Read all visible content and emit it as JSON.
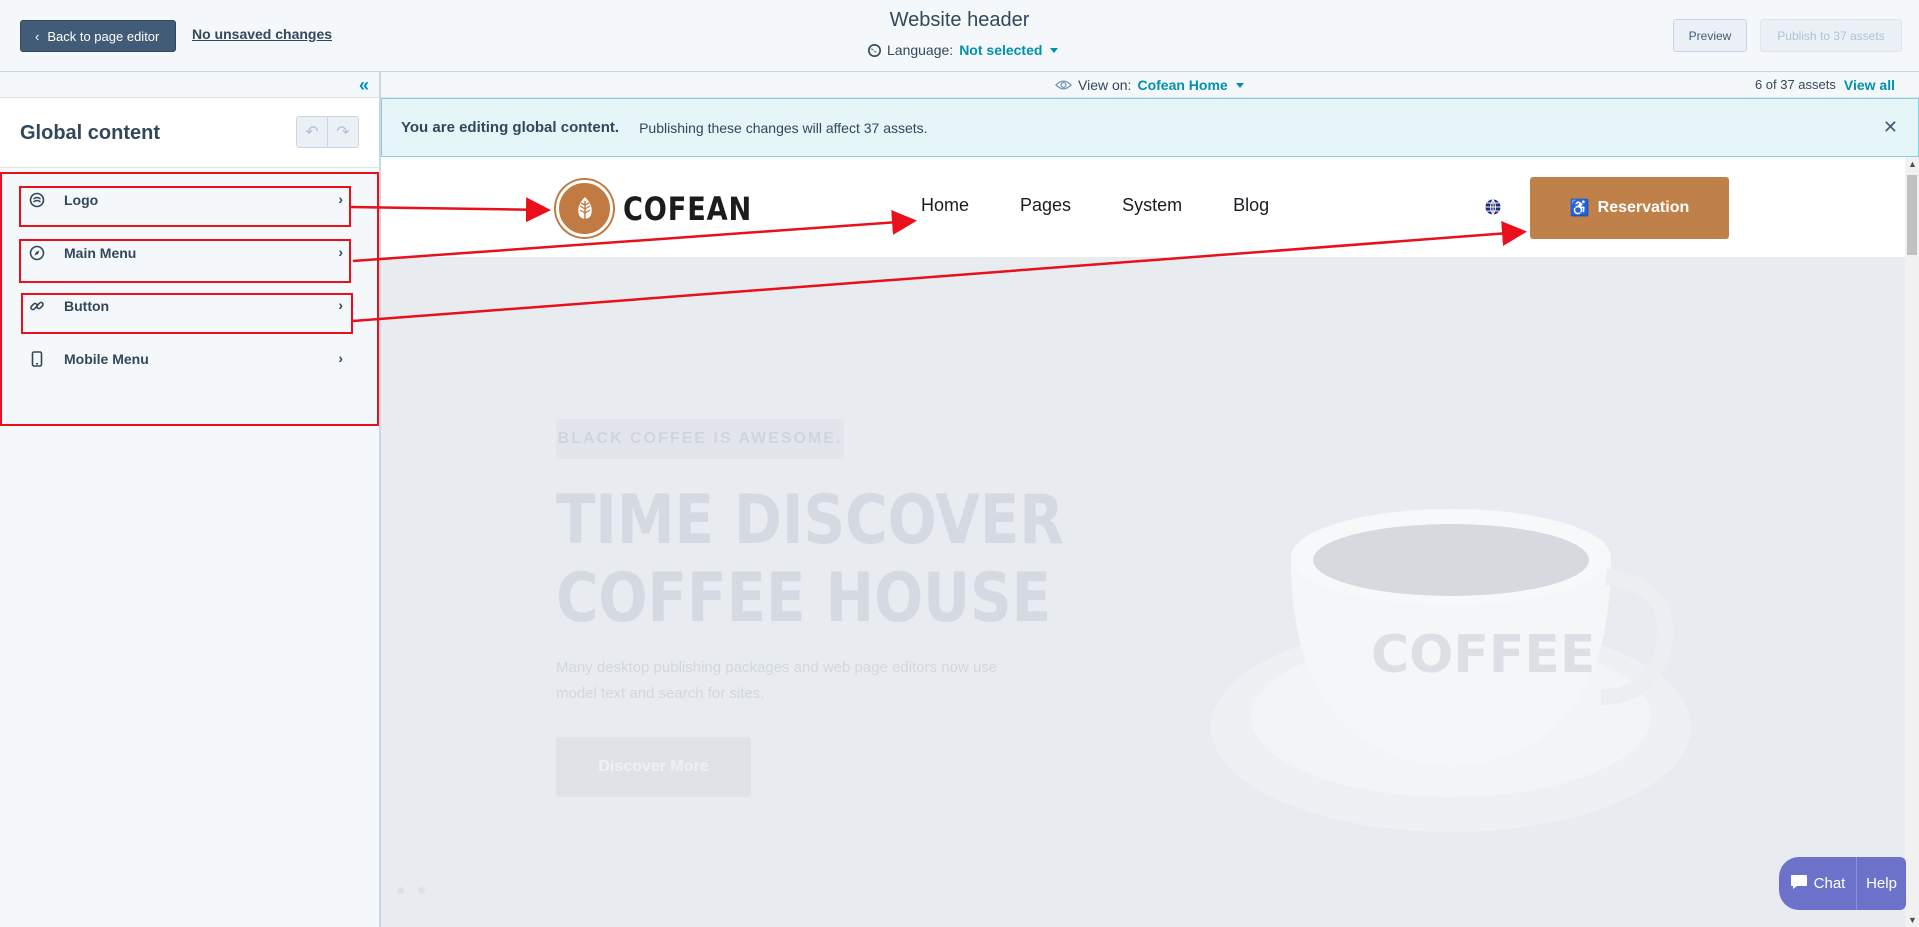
{
  "topbar": {
    "back_label": "Back to page editor",
    "unsaved_label": "No unsaved changes",
    "title": "Website header",
    "language_label": "Language:",
    "language_value": "Not selected",
    "preview_label": "Preview",
    "publish_label": "Publish to 37 assets"
  },
  "sidebar": {
    "title": "Global content",
    "items": [
      {
        "label": "Logo",
        "icon": "logo-icon"
      },
      {
        "label": "Main Menu",
        "icon": "compass-icon"
      },
      {
        "label": "Button",
        "icon": "link-icon"
      },
      {
        "label": "Mobile Menu",
        "icon": "mobile-icon"
      }
    ]
  },
  "viewbar": {
    "view_on_label": "View on:",
    "view_on_value": "Cofean Home",
    "assets_count": "6 of 37 assets",
    "view_all": "View all"
  },
  "banner": {
    "bold": "You are editing global content.",
    "text": "Publishing these changes will affect 37 assets."
  },
  "site": {
    "logo_text": "COFEAN",
    "nav": [
      "Home",
      "Pages",
      "System",
      "Blog"
    ],
    "reserve_label": "Reservation",
    "hero_tag": "BLACK COFFEE IS AWESOME.",
    "hero_title_1": "TIME DISCOVER",
    "hero_title_2": "COFFEE HOUSE",
    "hero_text": "Many desktop publishing packages and web page editors now use model text and search for sites.",
    "hero_button": "Discover More",
    "cup_text": "COFFEE"
  },
  "chat": {
    "chat_label": "Chat",
    "help_label": "Help"
  },
  "colors": {
    "accent": "#0091ae",
    "brand": "#c0804a",
    "annotation": "#e8101a",
    "dark_button": "#425b76"
  }
}
